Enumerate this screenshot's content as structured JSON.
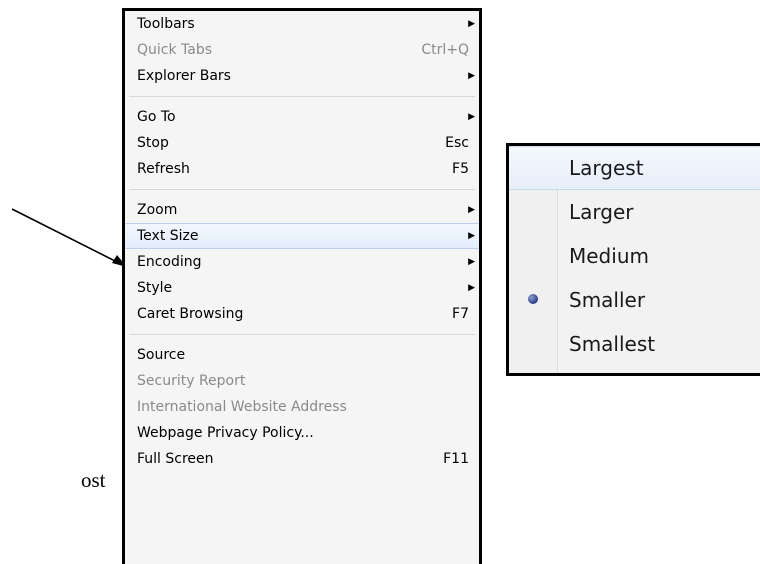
{
  "left_fragment": "ost",
  "menu": {
    "items": [
      {
        "label": "Toolbars",
        "shortcut": "",
        "submenu": true,
        "disabled": false
      },
      {
        "label": "Quick Tabs",
        "shortcut": "Ctrl+Q",
        "submenu": false,
        "disabled": true
      },
      {
        "label": "Explorer Bars",
        "shortcut": "",
        "submenu": true,
        "disabled": false
      },
      {
        "label": "Go To",
        "shortcut": "",
        "submenu": true,
        "disabled": false
      },
      {
        "label": "Stop",
        "shortcut": "Esc",
        "submenu": false,
        "disabled": false
      },
      {
        "label": "Refresh",
        "shortcut": "F5",
        "submenu": false,
        "disabled": false
      },
      {
        "label": "Zoom",
        "shortcut": "",
        "submenu": true,
        "disabled": false
      },
      {
        "label": "Text Size",
        "shortcut": "",
        "submenu": true,
        "disabled": false,
        "highlighted": true
      },
      {
        "label": "Encoding",
        "shortcut": "",
        "submenu": true,
        "disabled": false
      },
      {
        "label": "Style",
        "shortcut": "",
        "submenu": true,
        "disabled": false
      },
      {
        "label": "Caret Browsing",
        "shortcut": "F7",
        "submenu": false,
        "disabled": false
      },
      {
        "label": "Source",
        "shortcut": "",
        "submenu": false,
        "disabled": false
      },
      {
        "label": "Security Report",
        "shortcut": "",
        "submenu": false,
        "disabled": true
      },
      {
        "label": "International Website Address",
        "shortcut": "",
        "submenu": false,
        "disabled": true
      },
      {
        "label": "Webpage Privacy Policy...",
        "shortcut": "",
        "submenu": false,
        "disabled": false
      },
      {
        "label": "Full Screen",
        "shortcut": "F11",
        "submenu": false,
        "disabled": false
      }
    ]
  },
  "text_size_submenu": {
    "items": [
      {
        "label": "Largest",
        "highlighted": true,
        "selected": false
      },
      {
        "label": "Larger",
        "highlighted": false,
        "selected": false
      },
      {
        "label": "Medium",
        "highlighted": false,
        "selected": false
      },
      {
        "label": "Smaller",
        "highlighted": false,
        "selected": true
      },
      {
        "label": "Smallest",
        "highlighted": false,
        "selected": false
      }
    ]
  },
  "icons": {
    "submenu_arrow": "chevron-right-icon",
    "selected_marker": "radio-bullet-icon",
    "pointer": "arrow-pointer"
  },
  "colors": {
    "highlight": "#e3eefb",
    "disabled_text": "#8a8a8a",
    "bullet": "#2b3a84"
  }
}
